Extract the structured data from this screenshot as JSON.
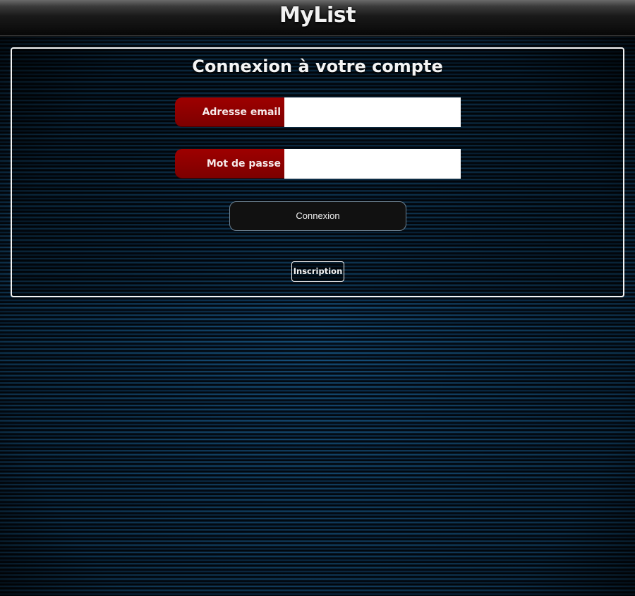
{
  "header": {
    "app_title": "MyList"
  },
  "login_panel": {
    "title": "Connexion à votre compte",
    "email": {
      "label": "Adresse email",
      "value": "",
      "placeholder": ""
    },
    "password": {
      "label": "Mot de passe",
      "value": "",
      "placeholder": ""
    },
    "submit_label": "Connexion",
    "signup_label": "Inscription"
  },
  "colors": {
    "label_background": "#8b0000",
    "panel_border": "#f4f4f4",
    "button_background": "#111111",
    "background_accent": "#1b5f8f"
  }
}
